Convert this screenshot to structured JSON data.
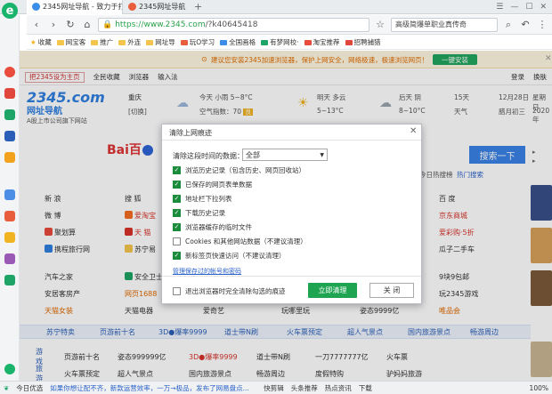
{
  "tabs": [
    {
      "title": "2345网址导航 - 致力于打造百年品牌",
      "active": true
    },
    {
      "title": "2345网址导航",
      "active": false
    }
  ],
  "address": {
    "host": "https://www.2345.com",
    "path": "/?k40645418",
    "search_value": "高级简爆单职业真传奇"
  },
  "bookmarks": [
    "收藏",
    "网宝客",
    "推广",
    "外连",
    "网址导",
    "玩O学习",
    "全国画格",
    "有梦网校·",
    "淘宝推荐",
    "招聘捕猎"
  ],
  "notice": {
    "text": "建议您安装2345加速浏览器，保护上网安全，网络极速，极速浏览网页！",
    "button": "一键安装"
  },
  "sitebar": {
    "sethome": "把2345设为主页",
    "items": [
      "全民收藏",
      "浏览器",
      "输入法"
    ],
    "right": [
      "登录",
      "换肤"
    ]
  },
  "logo": {
    "name": "2345.com",
    "tag": "网址导航",
    "slogan": "A股上市公司旗下网站"
  },
  "weather": {
    "city": "重庆",
    "district": "[切换]",
    "today": "今天 小雨 5~8°C",
    "aqi_label": "空气指数：70",
    "aqi_badge": "良",
    "tomorrow": "明天 多云",
    "tomorrow_temp": "5~13°C",
    "after": "后天 阴",
    "after_temp": "8~10°C",
    "days15": "15天",
    "days15_sub": "天气",
    "date": "12月28日",
    "lunar": "腊月初三",
    "weekday": "星期日",
    "year": "2020年"
  },
  "baidu": {
    "name": "Bai百",
    "search_button": "搜索一下",
    "suggest": "热门搜索",
    "suggest2": "今日热搜榜"
  },
  "grid": [
    [
      [
        "新 浪",
        ""
      ],
      [
        "搜 狐",
        ""
      ],
      [
        "百 度",
        ""
      ]
    ],
    [
      [
        "微 博",
        ""
      ],
      [
        "爱淘宝",
        "red"
      ],
      [
        "京东商城",
        "red"
      ]
    ],
    [
      [
        "聚划算",
        ""
      ],
      [
        "天 猫",
        "red"
      ],
      [
        "爱彩购·5折",
        "red"
      ]
    ],
    [
      [
        "携程旅行网",
        ""
      ],
      [
        "苏宁易",
        ""
      ],
      [
        "瓜子二手车",
        ""
      ]
    ]
  ],
  "grid2": [
    [
      "汽车之家",
      "安全卫士",
      "",
      "",
      "",
      "",
      "9块9包邮"
    ],
    [
      "安居客房产",
      "网页1688",
      "",
      "",
      "",
      "",
      "玩2345游戏"
    ],
    [
      "天猫女装",
      "天猫电器",
      "爱奇艺",
      "玩哪里玩",
      "姿态9999亿",
      "",
      "唯品会"
    ]
  ],
  "band": [
    "苏宁特卖",
    "页游前十名",
    "3D●爆率9999",
    "道士带N刷",
    "火车票预定",
    "超人气景点",
    "国内旅游景点",
    "畅游周边"
  ],
  "band_rows": [
    [
      "游戏",
      "页游前十名",
      "姿态999999亿",
      "3D●爆率9999",
      "道士带N刷",
      "一刀7777777亿",
      "火车票"
    ],
    [
      "旅游",
      "火车票预定",
      "超人气景点",
      "国内旅游景点",
      "畅游周边",
      "度假特购",
      "驴妈妈旅游"
    ]
  ],
  "statusbar": [
    "今日优选",
    "如果你想让配不齐，新款运营效率，一万→极品，发布了网易盘点...",
    "快剪辑",
    "头条推荐",
    "热点资讯",
    "下载",
    "100%"
  ],
  "dialog": {
    "title": "清除上网痕迹",
    "range_label": "清除这段时间的数据：",
    "range_value": "全部",
    "options": [
      {
        "label": "浏览历史记录（包含历史、网页回收站）",
        "checked": true
      },
      {
        "label": "已保存的网页表单数据",
        "checked": true
      },
      {
        "label": "地址栏下拉列表",
        "checked": true
      },
      {
        "label": "下载历史记录",
        "checked": true
      },
      {
        "label": "浏览器缓存的临时文件",
        "checked": true
      },
      {
        "label": "Cookies 和其他网站数据（不建议清理）",
        "checked": false
      },
      {
        "label": "新标签页快速访问（不建议清理）",
        "checked": true
      }
    ],
    "manage_link": "管理保存过的帐号和密码",
    "exit_option": "退出浏览器时完全清除勾选的痕迹",
    "confirm": "立即清理",
    "cancel": "关 闭"
  },
  "colors": {
    "accent": "#1fa552",
    "brand_blue": "#2f7fe0",
    "link": "#2a62c9"
  }
}
